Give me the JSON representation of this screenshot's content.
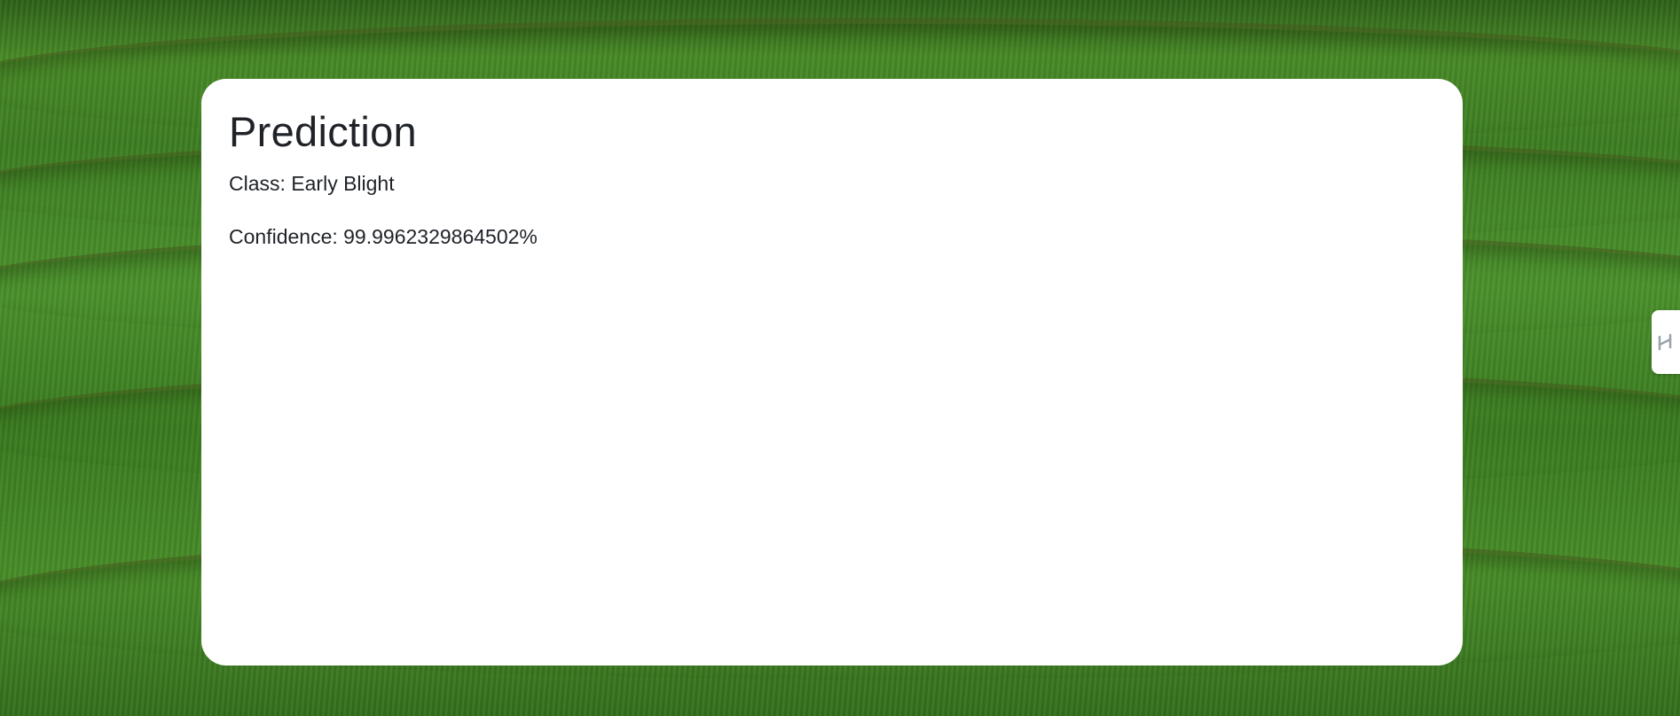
{
  "prediction": {
    "title": "Prediction",
    "class_line": "Class: Early Blight",
    "confidence_line": "Confidence: 99.9962329864502%"
  },
  "side_tab": {
    "icon": "collapse-handle-icon"
  },
  "colors": {
    "card_background": "#ffffff",
    "text": "#1f2328",
    "background_grass": "#4a8a2a"
  }
}
